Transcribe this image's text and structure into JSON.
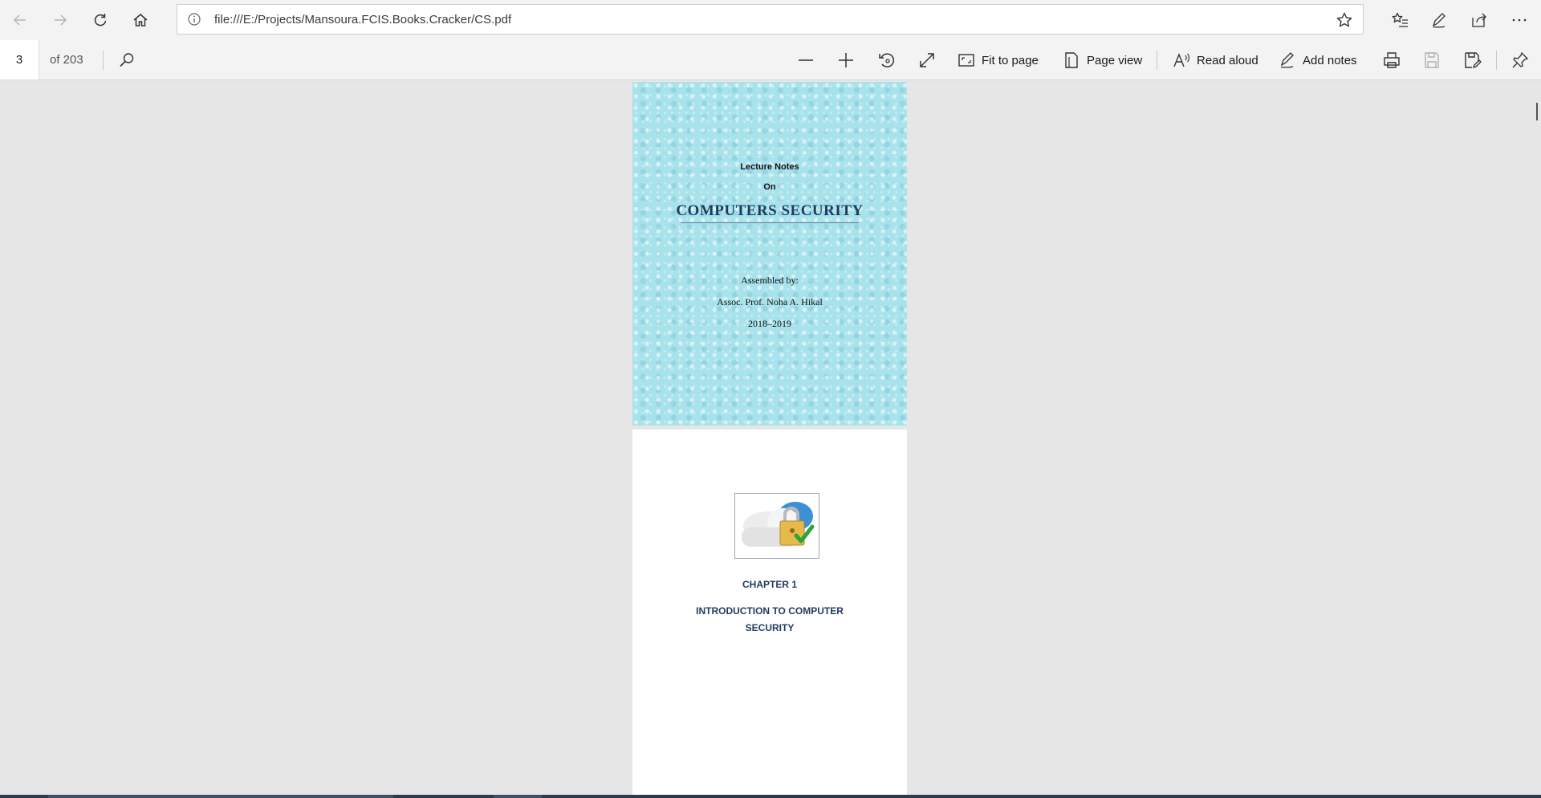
{
  "browser": {
    "url": "file:///E:/Projects/Mansoura.FCIS.Books.Cracker/CS.pdf",
    "icons": {
      "back": "back-arrow-icon",
      "forward": "forward-arrow-icon",
      "refresh": "refresh-icon",
      "home": "home-icon",
      "site_info": "info-icon",
      "favorite": "star-icon",
      "favorites_hub": "favorites-list-icon",
      "web_note": "pen-icon",
      "share": "share-icon",
      "more": "more-icon"
    }
  },
  "pdf_toolbar": {
    "current_page": "3",
    "page_total": "of 203",
    "fit_to_page": "Fit to page",
    "page_view": "Page view",
    "read_aloud": "Read aloud",
    "add_notes": "Add notes"
  },
  "document": {
    "cover": {
      "line1": "Lecture Notes",
      "line2": "On",
      "title": "COMPUTERS SECURITY",
      "assembled_by": "Assembled by:",
      "author": "Assoc. Prof. Noha A. Hikal",
      "years": "2018–2019",
      "background_color": "#a8e3ec"
    },
    "chapter_page": {
      "chapter": "CHAPTER 1",
      "title_line1": "INTRODUCTION TO COMPUTER",
      "title_line2": "SECURITY",
      "image_icon": "cloud-lock-check-icon"
    }
  },
  "colors": {
    "chrome_bg": "#f3f3f3",
    "viewport_bg": "#e6e6e6",
    "title_blue": "#1f3a5f"
  }
}
